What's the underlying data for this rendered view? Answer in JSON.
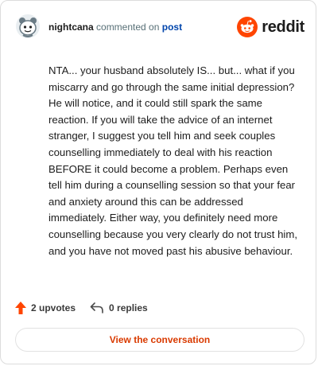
{
  "header": {
    "username": "nightcana",
    "action": "commented on",
    "post_link": "post",
    "logo_text": "reddit"
  },
  "comment": {
    "text": "NTA... your husband absolutely IS... but... what if you miscarry and go through the same initial depression? He will notice, and it could still spark the same reaction. If you will take the advice of an internet stranger, I suggest you tell him and seek couples counselling immediately to deal with his reaction BEFORE it could become a problem. Perhaps even tell him during a counselling session so that your fear and anxiety around this can be addressed immediately. Either way, you definitely need more counselling because you very clearly do not trust him, and you have not moved past his abusive behaviour."
  },
  "footer": {
    "upvotes": "2 upvotes",
    "replies": "0 replies"
  },
  "cta": {
    "label": "View the conversation"
  },
  "colors": {
    "brand_orange": "#ff4500",
    "link_blue": "#0045ac",
    "cta_text": "#d93a00"
  },
  "icons": [
    "avatar-snoo",
    "reddit-logo-icon",
    "upvote-arrow-icon",
    "reply-arrow-icon"
  ]
}
